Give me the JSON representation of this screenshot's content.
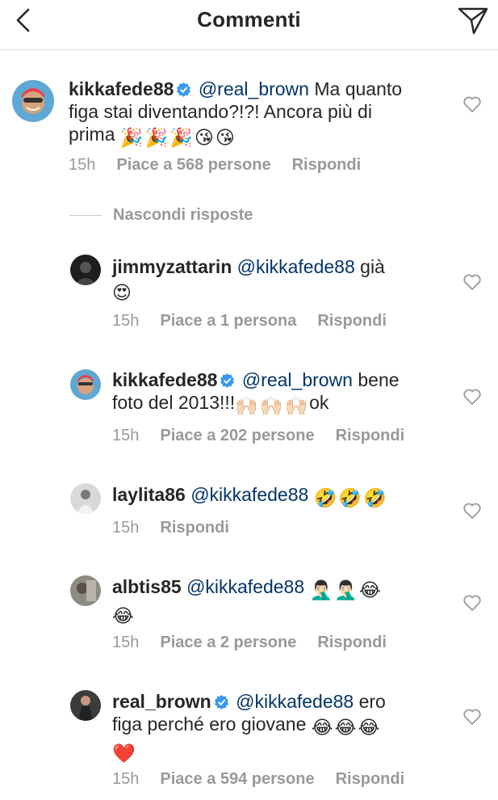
{
  "header": {
    "title": "Commenti"
  },
  "hide_replies_label": "Nascondi risposte",
  "comments": [
    {
      "username": "kikkafede88",
      "mention": "@real_brown",
      "text1": " Ma quanto",
      "text2": "figa stai diventando?!?! Ancora più di",
      "text3": "prima",
      "time": "15h",
      "likes": "Piace a 568 persone",
      "reply": "Rispondi"
    },
    {
      "username": "jimmyzattarin",
      "mention": "@kikkafede88",
      "text1": " già",
      "time": "15h",
      "likes": "Piace a 1 persona",
      "reply": "Rispondi"
    },
    {
      "username": "kikkafede88",
      "mention": "@real_brown",
      "text1": " bene",
      "text2": "foto del 2013!!!",
      "text3": "ok",
      "time": "15h",
      "likes": "Piace a 202 persone",
      "reply": "Rispondi"
    },
    {
      "username": "laylita86",
      "mention": "@kikkafede88",
      "time": "15h",
      "reply": "Rispondi"
    },
    {
      "username": "albtis85",
      "mention": "@kikkafede88",
      "time": "15h",
      "likes": "Piace a 2 persone",
      "reply": "Rispondi"
    },
    {
      "username": "real_brown",
      "mention": "@kikkafede88",
      "text1": " ero",
      "text2": "figa perché ero giovane",
      "time": "15h",
      "likes": "Piace a 594 persone",
      "reply": "Rispondi"
    }
  ],
  "emoji": {
    "party": "🎉",
    "kiss": "😘",
    "heart_eyes": "😍",
    "raising_hands": "🙌🏻",
    "rofl": "🤣",
    "facepalm": "🤦🏻‍♂️",
    "joy": "😂",
    "heart": "❤️"
  },
  "colors": {
    "text": "#262626",
    "meta": "#999999",
    "mention": "#003569",
    "verified": "#3897f0",
    "divider": "#dbdbdb"
  }
}
